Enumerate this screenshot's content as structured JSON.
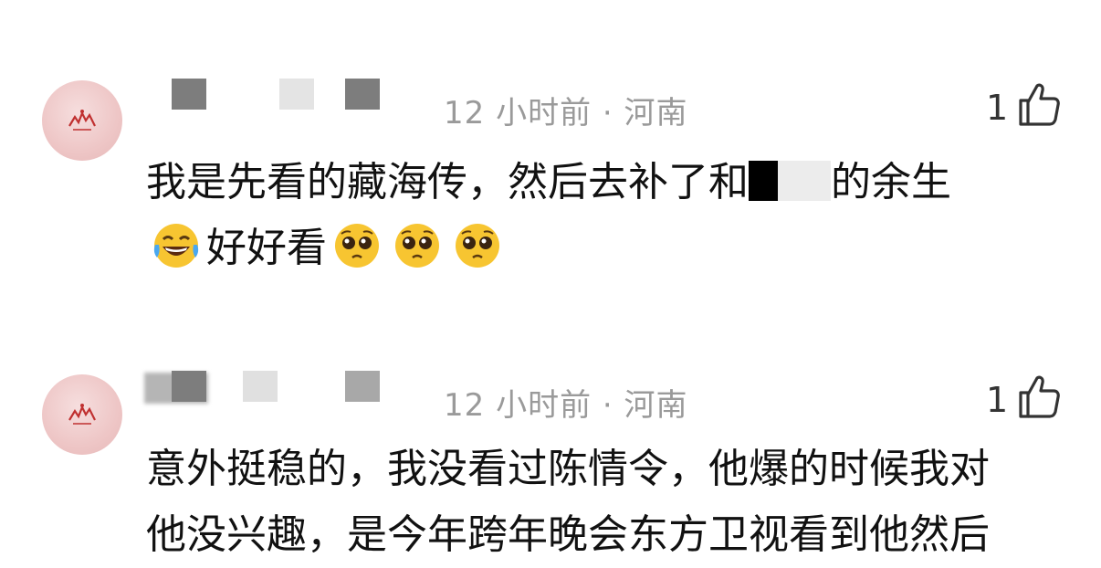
{
  "comments": [
    {
      "time_location": "12 小时前 · 河南",
      "likes": "1",
      "line1_a": "我是先看的藏海传，然后去补了和",
      "line1_b": "的余生",
      "line2_text": "好好看"
    },
    {
      "time_location": "12 小时前 · 河南",
      "likes": "1",
      "line1": "意外挺稳的，我没看过陈情令，他爆的时候我对",
      "line2": "他没兴趣，是今年跨年晚会东方卫视看到他然后"
    }
  ],
  "icons": {
    "like": "thumbs-up-icon",
    "avatar": "avatar-image",
    "tears_of_joy": "face-with-tears-of-joy-emoji",
    "pleading": "pleading-face-emoji"
  },
  "colors": {
    "meta_text": "#9a9a9a",
    "avatar_bg": "#eec6c6",
    "text": "#111111"
  }
}
